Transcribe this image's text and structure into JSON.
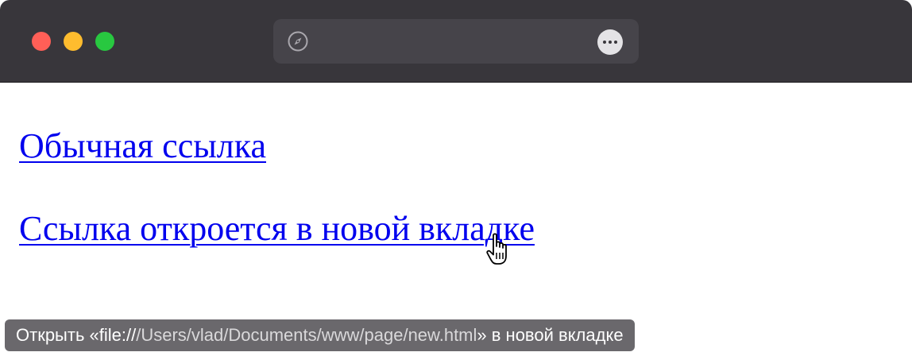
{
  "window": {
    "traffic_lights": {
      "close_color": "#ff5f57",
      "minimize_color": "#febc2e",
      "zoom_color": "#28c840"
    },
    "address_bar": {
      "value": "",
      "left_icon": "compass-icon",
      "right_icon": "more-options-icon"
    }
  },
  "page": {
    "links": [
      {
        "label": "Обычная ссылка",
        "color": "#0000ee"
      },
      {
        "label": "Ссылка откроется в новой вкладке",
        "color": "#0000ee"
      }
    ]
  },
  "status_bar": {
    "prefix": "Открыть «",
    "scheme": "file://",
    "path": "/Users/vlad/Documents/www/page/new.html",
    "suffix": "» в новой вкладке"
  },
  "pointer": {
    "icon": "hand-pointer-icon"
  }
}
